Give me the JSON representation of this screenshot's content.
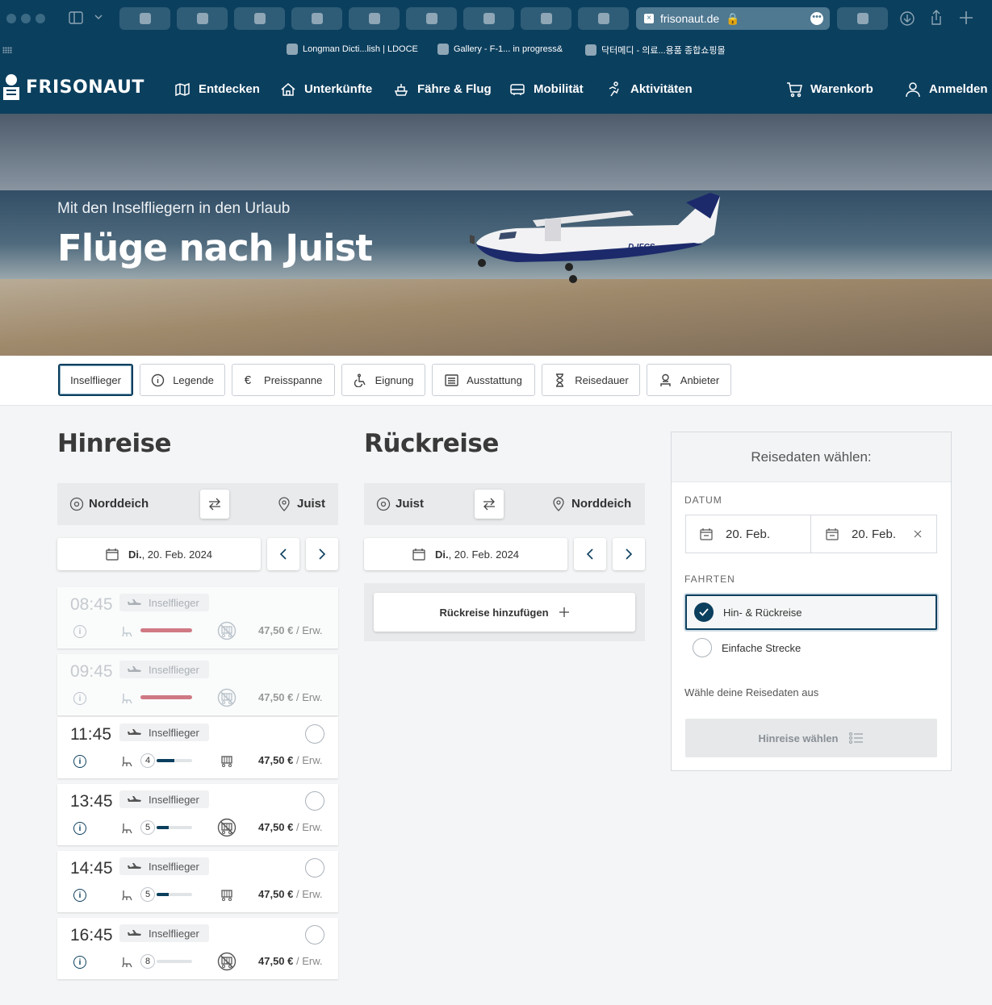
{
  "browser": {
    "url": "frisonaut.de",
    "bookmarks": [
      "Longman Dicti...lish | LDOCE",
      "Gallery - F-1... in progress&",
      "닥터메디 - 의료...용품 종합쇼핑몰"
    ]
  },
  "site": {
    "logo": "FRISONAUT",
    "nav": [
      "Entdecken",
      "Unterkünfte",
      "Fähre & Flug",
      "Mobilität",
      "Aktivitäten"
    ],
    "cart": "Warenkorb",
    "login": "Anmelden"
  },
  "hero": {
    "subtitle": "Mit den Inselfliegern in den Urlaub",
    "title": "Flüge nach Juist",
    "plane_reg": "D-IFCS"
  },
  "filters": [
    "Inselflieger",
    "Legende",
    "Preisspanne",
    "Eignung",
    "Ausstattung",
    "Reisedauer",
    "Anbieter"
  ],
  "outbound": {
    "heading": "Hinreise",
    "from": "Norddeich",
    "to": "Juist",
    "date_day": "Di.",
    "date_rest": ", 20. Feb. 2024",
    "flights": [
      {
        "time": "08:45",
        "operator": "Inselflieger",
        "price": "47,50 €",
        "unit": " / Erw.",
        "seats": "",
        "load": 1.0,
        "available": false
      },
      {
        "time": "09:45",
        "operator": "Inselflieger",
        "price": "47,50 €",
        "unit": " / Erw.",
        "seats": "",
        "load": 1.0,
        "available": false
      },
      {
        "time": "11:45",
        "operator": "Inselflieger",
        "price": "47,50 €",
        "unit": " / Erw.",
        "seats": "4",
        "load": 0.5,
        "available": true
      },
      {
        "time": "13:45",
        "operator": "Inselflieger",
        "price": "47,50 €",
        "unit": " / Erw.",
        "seats": "5",
        "load": 0.35,
        "available": true
      },
      {
        "time": "14:45",
        "operator": "Inselflieger",
        "price": "47,50 €",
        "unit": " / Erw.",
        "seats": "5",
        "load": 0.35,
        "available": true
      },
      {
        "time": "16:45",
        "operator": "Inselflieger",
        "price": "47,50 €",
        "unit": " / Erw.",
        "seats": "8",
        "load": 0.0,
        "available": true
      }
    ]
  },
  "return": {
    "heading": "Rückreise",
    "from": "Juist",
    "to": "Norddeich",
    "date_day": "Di.",
    "date_rest": ", 20. Feb. 2024",
    "add_label": "Rückreise hinzufügen"
  },
  "panel": {
    "title": "Reisedaten wählen:",
    "date_label": "DATUM",
    "date_from": "20. Feb.",
    "date_to": "20. Feb.",
    "trips_label": "FAHRTEN",
    "option_round": "Hin- & Rückreise",
    "option_single": "Einfache Strecke",
    "hint": "Wähle deine Reisedaten aus",
    "submit": "Hinreise wählen"
  },
  "colors": {
    "brand": "#0b3f5e",
    "full": "#cf7984"
  }
}
